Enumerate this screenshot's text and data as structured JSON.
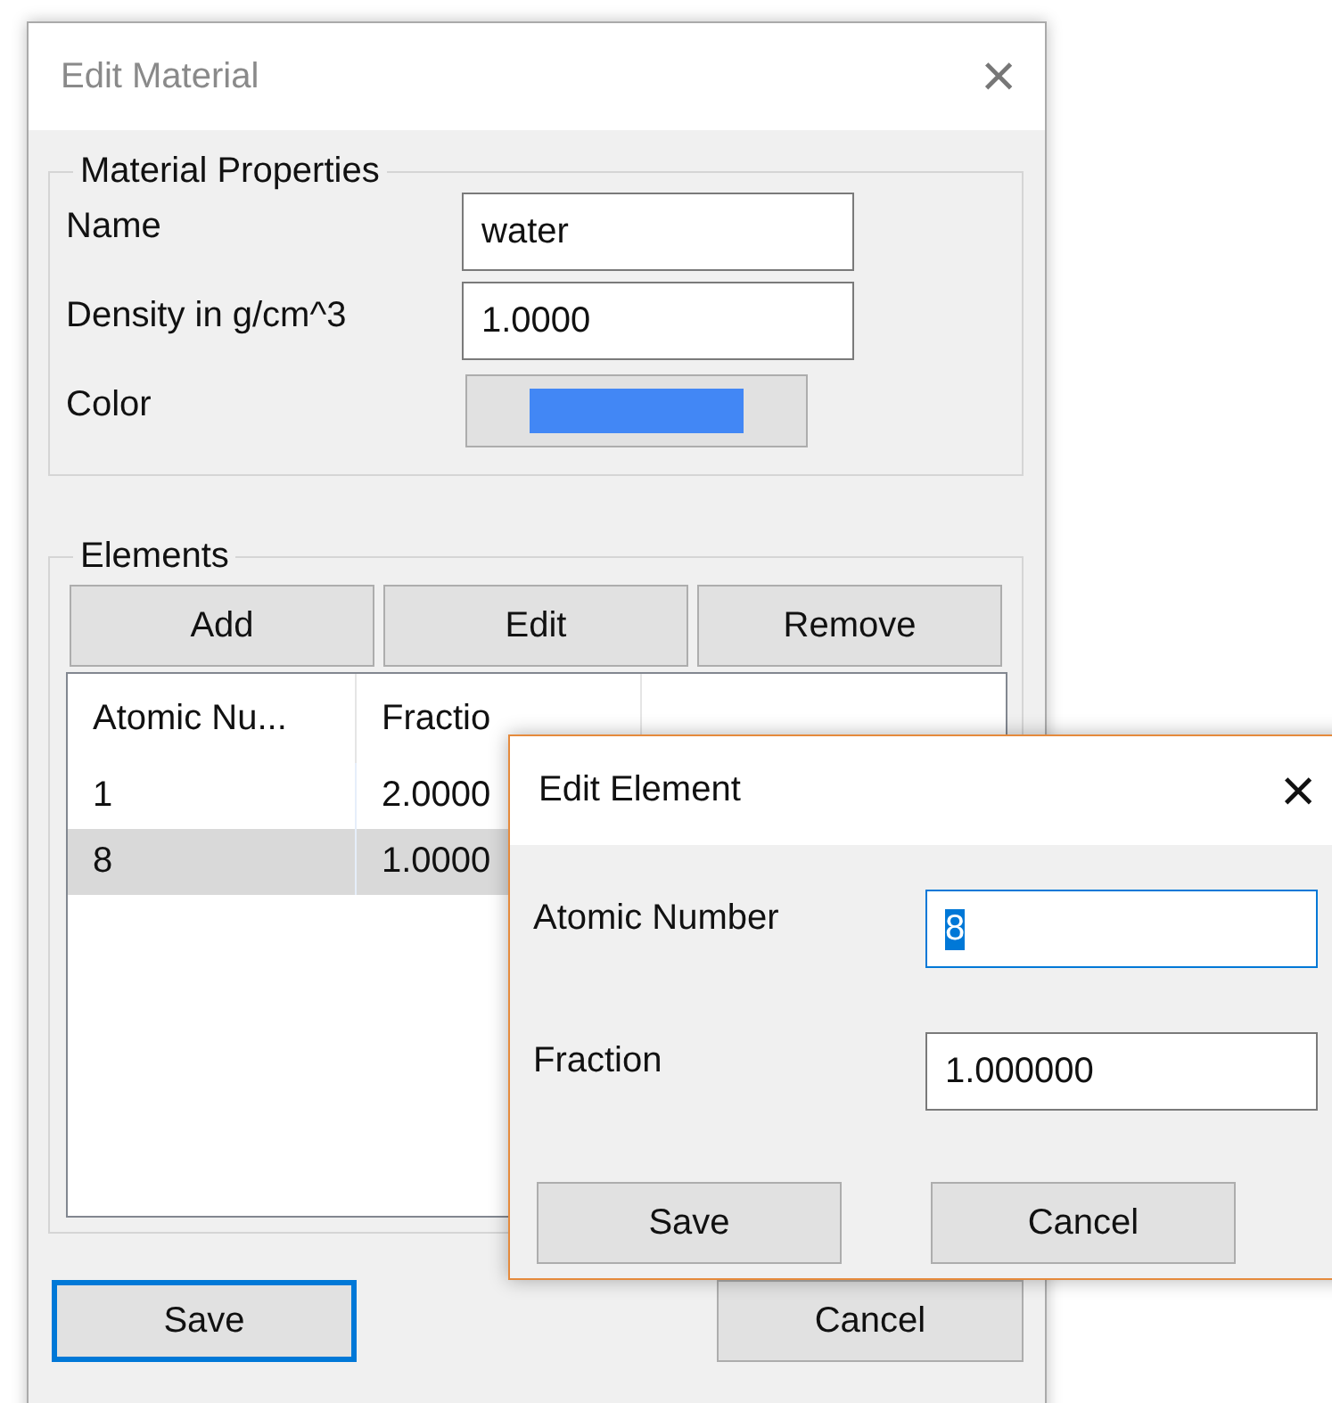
{
  "window": {
    "title": "Edit Material",
    "close": "×"
  },
  "material_properties": {
    "title": "Material Properties",
    "fields": [
      {
        "kind": "text",
        "label": "Name",
        "value": "water"
      },
      {
        "kind": "text",
        "label": "Density in g/cm^3",
        "value": "1.0000"
      },
      {
        "kind": "color",
        "label": "Color",
        "color": "#4287f5"
      }
    ]
  },
  "elements": {
    "title": "Elements",
    "buttons": [
      "Add",
      "Edit",
      "Remove"
    ],
    "table": {
      "columns": [
        "Atomic Nu...",
        "Fractio"
      ],
      "rows": [
        {
          "cells": [
            "1",
            "2.0000"
          ],
          "selected": false
        },
        {
          "cells": [
            "8",
            "1.0000"
          ],
          "selected": true
        }
      ]
    }
  },
  "buttons": [
    {
      "label": "Save",
      "default": true
    },
    {
      "label": "Cancel",
      "default": false
    }
  ],
  "dialog": {
    "title": "Edit Element",
    "close": "×",
    "fields": [
      {
        "label": "Atomic Number",
        "value": "8",
        "focused": true
      },
      {
        "label": "Fraction",
        "value": "1.000000",
        "focused": false
      }
    ],
    "buttons": [
      {
        "label": "Save",
        "default": false
      },
      {
        "label": "Cancel",
        "default": false
      }
    ]
  }
}
